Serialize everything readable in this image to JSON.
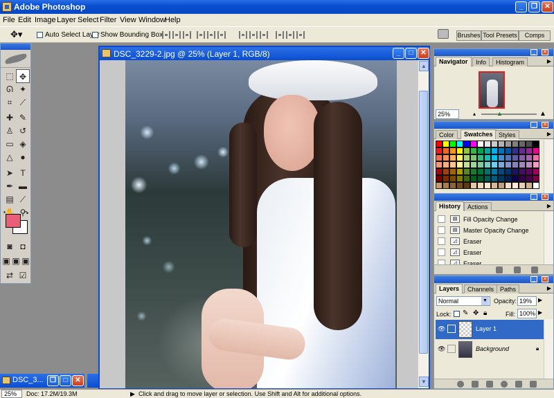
{
  "app": {
    "title": "Adobe Photoshop"
  },
  "menu": [
    "File",
    "Edit",
    "Image",
    "Layer",
    "Select",
    "Filter",
    "View",
    "Window",
    "Help"
  ],
  "options": {
    "auto_select": "Auto Select Layer",
    "bounding_box": "Show Bounding Box",
    "well_tabs": [
      "Brushes",
      "Tool Presets",
      "Comps"
    ]
  },
  "document": {
    "title": "DSC_3229-2.jpg @ 25% (Layer 1, RGB/8)"
  },
  "navigator": {
    "tabs": [
      "Navigator",
      "Info",
      "Histogram"
    ],
    "zoom": "25%"
  },
  "color_palette": {
    "tabs": [
      "Color",
      "Swatches",
      "Styles"
    ],
    "swatches": [
      "#ff0000",
      "#ffff00",
      "#00ff00",
      "#00ffff",
      "#0000ff",
      "#ff00ff",
      "#ffffff",
      "#e6e6e6",
      "#cccccc",
      "#b3b3b3",
      "#999999",
      "#808080",
      "#666666",
      "#4d4d4d",
      "#000000",
      "#ed1c24",
      "#f26522",
      "#f7941d",
      "#fff200",
      "#8dc63f",
      "#39b54a",
      "#00a651",
      "#00a99d",
      "#00aeef",
      "#0072bc",
      "#0054a6",
      "#2e3192",
      "#662d91",
      "#92278f",
      "#ec008c",
      "#f26c4f",
      "#f68e56",
      "#fbaf5d",
      "#fff568",
      "#acd373",
      "#7cc576",
      "#3cb878",
      "#1cbbb4",
      "#00bff3",
      "#448ccb",
      "#5674b9",
      "#605ca8",
      "#8560a8",
      "#a864a8",
      "#f06eaa",
      "#f7977a",
      "#f9ad81",
      "#fdc68a",
      "#fff79a",
      "#c4df9b",
      "#a3d39c",
      "#82ca9d",
      "#7accc8",
      "#6dcff6",
      "#7da7d9",
      "#8393ca",
      "#8781bd",
      "#a187be",
      "#bd8cbf",
      "#f49ac1",
      "#9e0b0f",
      "#a0410d",
      "#a36209",
      "#aba000",
      "#598527",
      "#1a7b30",
      "#007236",
      "#00746b",
      "#0076a3",
      "#004a80",
      "#003471",
      "#1b1464",
      "#440e62",
      "#630460",
      "#9e005d",
      "#790000",
      "#7b2e00",
      "#7d4900",
      "#827b00",
      "#406618",
      "#005e20",
      "#005826",
      "#005952",
      "#005b7f",
      "#003663",
      "#002157",
      "#0d004c",
      "#32004b",
      "#4b0049",
      "#7b0046",
      "#c69c6d",
      "#a67c52",
      "#8c6239",
      "#754c24",
      "#603913",
      "#e6c8a8",
      "#f0d8c0",
      "#ffe8d0",
      "#d8b898",
      "#c0a080",
      "#f4ddc8",
      "#fae8d8",
      "#e8d0b8",
      "#d0b090",
      "#ffffff"
    ]
  },
  "history": {
    "tabs": [
      "History",
      "Actions"
    ],
    "items": [
      {
        "label": "Fill Opacity Change",
        "icon": "document-icon"
      },
      {
        "label": "Master Opacity Change",
        "icon": "document-icon"
      },
      {
        "label": "Eraser",
        "icon": "eraser-icon"
      },
      {
        "label": "Eraser",
        "icon": "eraser-icon"
      },
      {
        "label": "Eraser",
        "icon": "eraser-icon"
      }
    ]
  },
  "layers": {
    "tabs": [
      "Layers",
      "Channels",
      "Paths"
    ],
    "blend_mode": "Normal",
    "opacity_label": "Opacity:",
    "opacity": "19%",
    "lock_label": "Lock:",
    "fill_label": "Fill:",
    "fill": "100%",
    "items": [
      {
        "name": "Layer 1",
        "selected": true
      },
      {
        "name": "Background",
        "selected": false
      }
    ]
  },
  "minimized_doc": {
    "title": "DSC_3..."
  },
  "status": {
    "zoom": "25%",
    "doc": "Doc: 17.2M/19.3M",
    "hint": "Click and drag to move layer or selection.  Use Shift and Alt for additional options."
  },
  "colors": {
    "foreground": "#e85f78",
    "background": "#ffffff",
    "accent": "#0a4ecf"
  }
}
